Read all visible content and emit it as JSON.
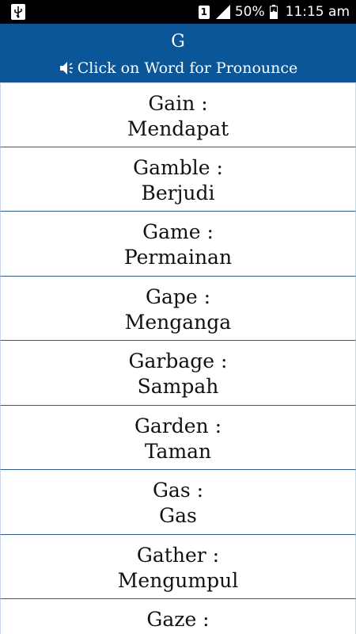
{
  "status_bar": {
    "sim": "1",
    "battery": "50%",
    "time": "11:15 am"
  },
  "header": {
    "title": "G",
    "subtitle": "Click on Word for Pronounce",
    "icon": "speaker-icon"
  },
  "words": [
    {
      "en": "Gain :",
      "id": "Mendapat"
    },
    {
      "en": "Gamble :",
      "id": "Berjudi"
    },
    {
      "en": "Game :",
      "id": "Permainan"
    },
    {
      "en": "Gape :",
      "id": "Menganga"
    },
    {
      "en": "Garbage :",
      "id": "Sampah"
    },
    {
      "en": "Garden :",
      "id": "Taman"
    },
    {
      "en": "Gas :",
      "id": "Gas"
    },
    {
      "en": "Gather :",
      "id": "Mengumpul"
    },
    {
      "en": "Gaze :",
      "id": ""
    }
  ],
  "colors": {
    "header_bg": "#0a5699",
    "status_bg": "#000000",
    "divider": "#2e5b8a"
  }
}
